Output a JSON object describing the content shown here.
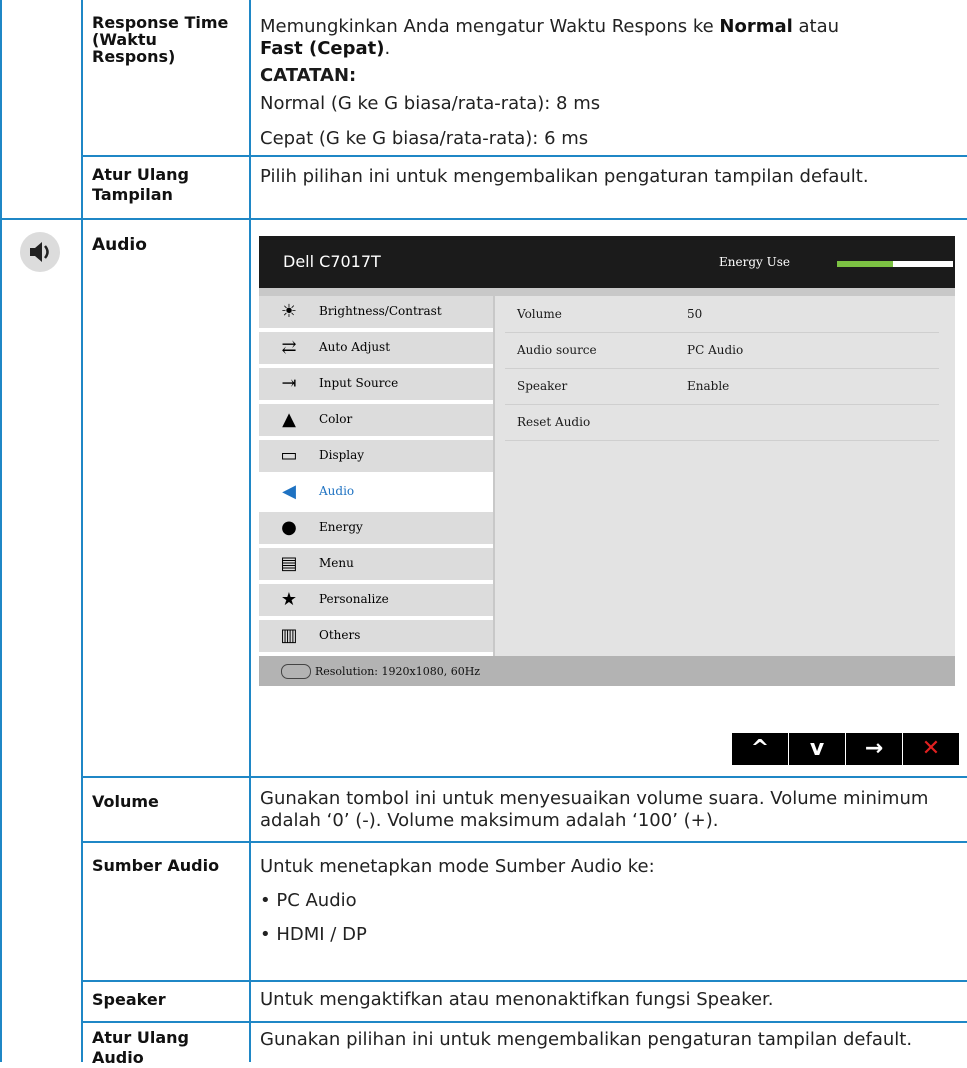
{
  "rows": {
    "response_time": {
      "label": "Response Time (Waktu Respons)",
      "desc_pre": "Memungkinkan Anda mengatur Waktu Respons ke ",
      "desc_b1": "Normal",
      "desc_mid": " atau",
      "desc_b2": "Fast (Cepat)",
      "desc_end": ".",
      "note_title": "CATATAN:",
      "note_normal": "Normal (G ke G biasa/rata-rata): 8 ms",
      "note_fast": "Cepat (G ke G biasa/rata-rata): 6 ms"
    },
    "reset_display": {
      "label": "Atur Ulang Tampilan",
      "desc": "Pilih pilihan ini untuk mengembalikan pengaturan tampilan default."
    },
    "audio": {
      "label": "Audio"
    },
    "volume": {
      "label": "Volume",
      "desc": "Gunakan tombol ini untuk menyesuaikan volume suara. Volume minimum adalah ‘0’ (-). Volume maksimum adalah ‘100’ (+)."
    },
    "audio_source": {
      "label": "Sumber Audio",
      "desc": "Untuk menetapkan mode Sumber Audio ke:",
      "opt1": "• PC Audio",
      "opt2": "• HDMI / DP"
    },
    "speaker": {
      "label": "Speaker",
      "desc": "Untuk mengaktifkan atau menonaktifkan fungsi Speaker."
    },
    "reset_audio": {
      "label": "Atur Ulang Audio",
      "desc": "Gunakan pilihan ini untuk mengembalikan pengaturan tampilan default."
    }
  },
  "osd": {
    "title": "Dell C7017T",
    "energy_label": "Energy Use",
    "energy_level": 0.48,
    "menu": [
      {
        "label": "Brightness/Contrast",
        "icon": "brightness-icon",
        "glyph": "☀"
      },
      {
        "label": "Auto Adjust",
        "icon": "auto-adjust-icon",
        "glyph": "⇄"
      },
      {
        "label": "Input Source",
        "icon": "input-source-icon",
        "glyph": "⇥"
      },
      {
        "label": "Color",
        "icon": "color-icon",
        "glyph": "▲"
      },
      {
        "label": "Display",
        "icon": "display-icon",
        "glyph": "▭"
      },
      {
        "label": "Audio",
        "icon": "speaker-icon",
        "glyph": "◀"
      },
      {
        "label": "Energy",
        "icon": "energy-icon",
        "glyph": "●"
      },
      {
        "label": "Menu",
        "icon": "menu-icon",
        "glyph": "▤"
      },
      {
        "label": "Personalize",
        "icon": "star-icon",
        "glyph": "★"
      },
      {
        "label": "Others",
        "icon": "others-icon",
        "glyph": "▥"
      }
    ],
    "selected": "Audio",
    "settings": [
      {
        "key": "Volume",
        "value": "50"
      },
      {
        "key": "Audio source",
        "value": "PC Audio"
      },
      {
        "key": "Speaker",
        "value": "Enable"
      },
      {
        "key": "Reset Audio",
        "value": ""
      }
    ],
    "footer": "Resolution: 1920x1080, 60Hz",
    "nav": [
      {
        "icon": "up-arrow-icon",
        "glyph": "^"
      },
      {
        "icon": "down-arrow-icon",
        "glyph": "v"
      },
      {
        "icon": "right-arrow-icon",
        "glyph": "→"
      },
      {
        "icon": "close-icon",
        "glyph": "✕"
      }
    ]
  },
  "colors": {
    "rule": "#1f87c6",
    "energy": "#7cc243",
    "selected": "#1e72c2",
    "close": "#e12020"
  }
}
